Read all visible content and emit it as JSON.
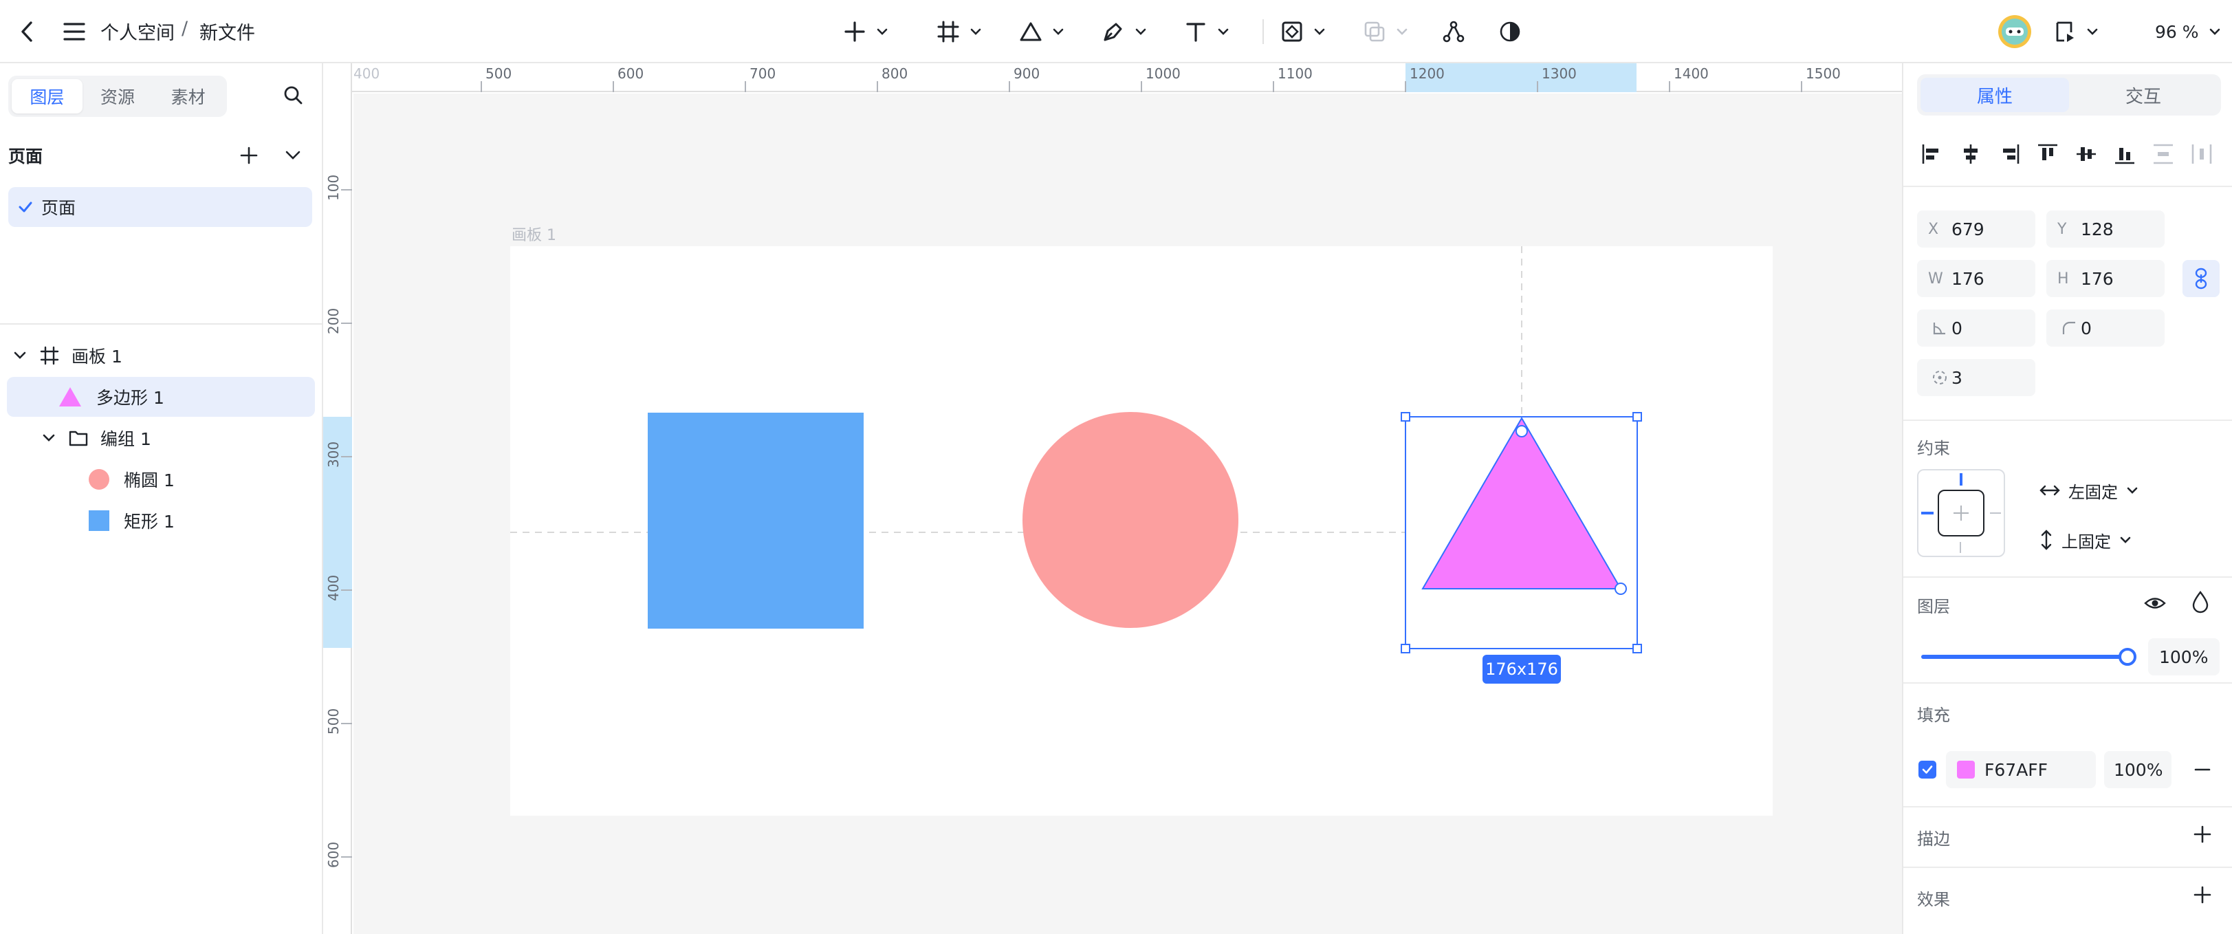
{
  "topbar": {
    "breadcrumb_space": "个人空间",
    "breadcrumb_sep": "/",
    "breadcrumb_file": "新文件",
    "zoom": "96 %"
  },
  "left": {
    "tabs": [
      "图层",
      "资源",
      "素材"
    ],
    "pages_title": "页面",
    "page_item": "页面",
    "layers": {
      "artboard": "画板 1",
      "polygon": "多边形 1",
      "group": "编组 1",
      "ellipse": "椭圆 1",
      "rect": "矩形 1"
    }
  },
  "ruler": {
    "h_ticks": [
      "400",
      "500",
      "600",
      "700",
      "800",
      "900",
      "1000",
      "1100",
      "1200",
      "1300",
      "1400",
      "1500"
    ],
    "v_ticks": [
      "100",
      "200",
      "300",
      "400",
      "500",
      "600"
    ]
  },
  "canvas": {
    "artboard_label": "画板 1",
    "size_badge": "176x176",
    "colors": {
      "rect": "#60AAF8",
      "ellipse": "#FC9F9F",
      "polygon": "#F67AFF",
      "selection": "#3370FF"
    }
  },
  "right": {
    "tabs": [
      "属性",
      "交互"
    ],
    "x_label": "X",
    "x": "679",
    "y_label": "Y",
    "y": "128",
    "w_label": "W",
    "w": "176",
    "h_label": "H",
    "h": "176",
    "rotation": "0",
    "radius": "0",
    "sides": "3",
    "constraint_title": "约束",
    "constraint_h": "左固定",
    "constraint_v": "上固定",
    "layer_title": "图层",
    "opacity": "100%",
    "opacity_value": 1.0,
    "fill_title": "填充",
    "fill_hex": "F67AFF",
    "fill_opacity": "100%",
    "stroke_title": "描边",
    "effect_title": "效果"
  }
}
